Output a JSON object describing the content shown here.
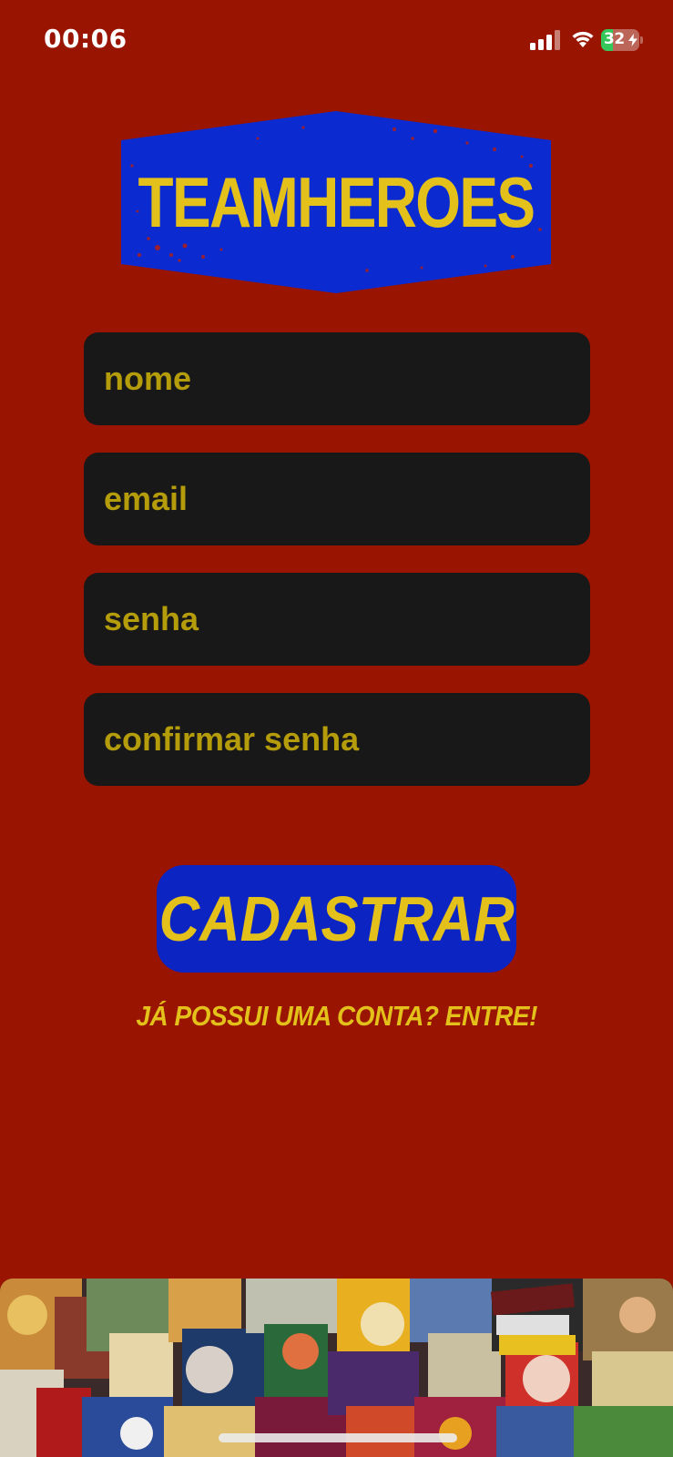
{
  "status_bar": {
    "time": "00:06",
    "battery": "32",
    "battery_level": 0.32,
    "icons": [
      "signal-icon",
      "wifi-icon",
      "battery-charging-icon"
    ]
  },
  "logo": {
    "text": "TEAMHEROES"
  },
  "form": {
    "nome_placeholder": "nome",
    "email_placeholder": "email",
    "senha_placeholder": "senha",
    "confirmar_placeholder": "confirmar senha"
  },
  "actions": {
    "register_label": "CADASTRAR",
    "login_link": "JÁ POSSUI UMA CONTA? ENTRE!"
  },
  "colors": {
    "background": "#991401",
    "accent_yellow": "#e3c11a",
    "button_blue": "#0b24c2",
    "field_background": "#181818",
    "placeholder": "#b59c0a"
  }
}
